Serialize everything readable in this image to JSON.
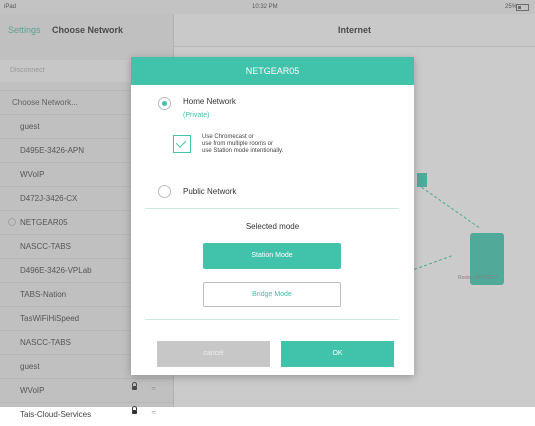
{
  "status_bar": {
    "carrier": "iPad",
    "time": "10:32 PM",
    "battery": "25%"
  },
  "sidebar": {
    "back_label": "Settings",
    "title": "Choose Network",
    "disconnect_label": "Disconnect",
    "list_header": "Choose Network...",
    "networks": [
      {
        "name": "guest"
      },
      {
        "name": "D495E-3426-APN"
      },
      {
        "name": "WVoIP"
      },
      {
        "name": "D472J-3426-CX"
      },
      {
        "name": "NETGEAR05"
      },
      {
        "name": "NASCC-TABS"
      },
      {
        "name": "D496E-3426-VPLab"
      },
      {
        "name": "TABS-Nation"
      },
      {
        "name": "TasWiFiHiSpeed"
      },
      {
        "name": "NASCC-TABS"
      },
      {
        "name": "guest"
      },
      {
        "name": "WVoIP"
      },
      {
        "name": "Tais-Cloud-Services"
      }
    ]
  },
  "main": {
    "title": "Internet",
    "device_caption": "Rooter_id PTEFV"
  },
  "modal": {
    "title": "NETGEAR05",
    "home_network": {
      "label": "Home Network",
      "sublabel": "(Private)",
      "selected": true
    },
    "checkbox": {
      "line1": "Use Chromecast or",
      "line2": "use from multiple rooms or",
      "line3": "use Station mode intentionally.",
      "checked": true
    },
    "public_network": {
      "label": "Public Network",
      "selected": false
    },
    "selected_mode_heading": "Selected mode",
    "station_button": "Station Mode",
    "bridge_button": "Bridge Mode",
    "cancel_button": "cancel",
    "ok_button": "OK"
  },
  "colors": {
    "accent": "#40c2ab",
    "sidebar_bg": "#e6e6e6",
    "cancel_bg": "#c7c7c7"
  }
}
